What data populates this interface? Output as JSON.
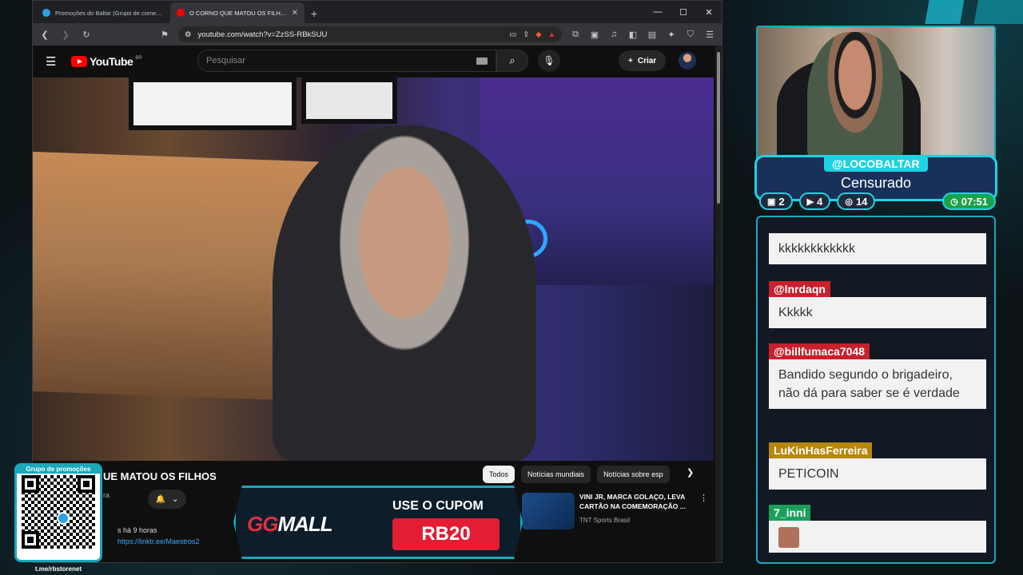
{
  "browser": {
    "tabs": [
      {
        "title": "Promoções do Baltar (Grupo de comentários)",
        "favicon_color": "#2aa3e0",
        "active": false
      },
      {
        "title": "O CORNO QUE MATOU OS FILHOS - YouTube",
        "favicon_color": "#ff0000",
        "active": true
      }
    ],
    "newtab": "+",
    "win_min": "—",
    "win_max": "☐",
    "win_close": "✕",
    "url": "youtube.com/watch?v=ZzSS-RBkSUU"
  },
  "youtube": {
    "logo": "YouTube",
    "country": "BR",
    "search_placeholder": "Pesquisar",
    "create_label": "Criar",
    "video_title": "UE MATOU OS FILHOS",
    "channel_partial": "ra",
    "meta": "s há 9 horas",
    "link": "https://linktr.ee/Maestros2",
    "chips": [
      "Todos",
      "Notícias mundiais",
      "Notícias sobre esp"
    ],
    "rec": {
      "title": "VINI JR, MARCA GOLAÇO, LEVA CARTÃO NA COMEMORAÇÃO ...",
      "channel": "TNT Sports Brasil"
    }
  },
  "overlay": {
    "qr_title": "Grupo de promoções",
    "qr_url": "t.me/rbstorenet",
    "promo_brand_a": "GG",
    "promo_brand_b": "MALL",
    "promo_use": "USE O CUPOM",
    "promo_code": "RB20"
  },
  "stream": {
    "handle": "@LOCOBALTAR",
    "status": "Censurado",
    "stats": {
      "twitch": "2",
      "youtube": "4",
      "kick": "14",
      "time": "07:51"
    }
  },
  "chat": [
    {
      "user": "",
      "text": "kkkkkkkkkkkk",
      "color": "#1aa05a"
    },
    {
      "user": "@lnrdaqn",
      "text": "Kkkkk",
      "color": "#c8202c"
    },
    {
      "user": "@billfumaca7048",
      "text": "Bandido segundo o brigadeiro, não dá para saber se é verdade",
      "color": "#c8202c"
    },
    {
      "user": "LuKinHasFerreira",
      "text": "PETICOIN",
      "color": "#b8860b"
    },
    {
      "user": "7_inni",
      "text": "",
      "color": "#1aa05a"
    }
  ]
}
